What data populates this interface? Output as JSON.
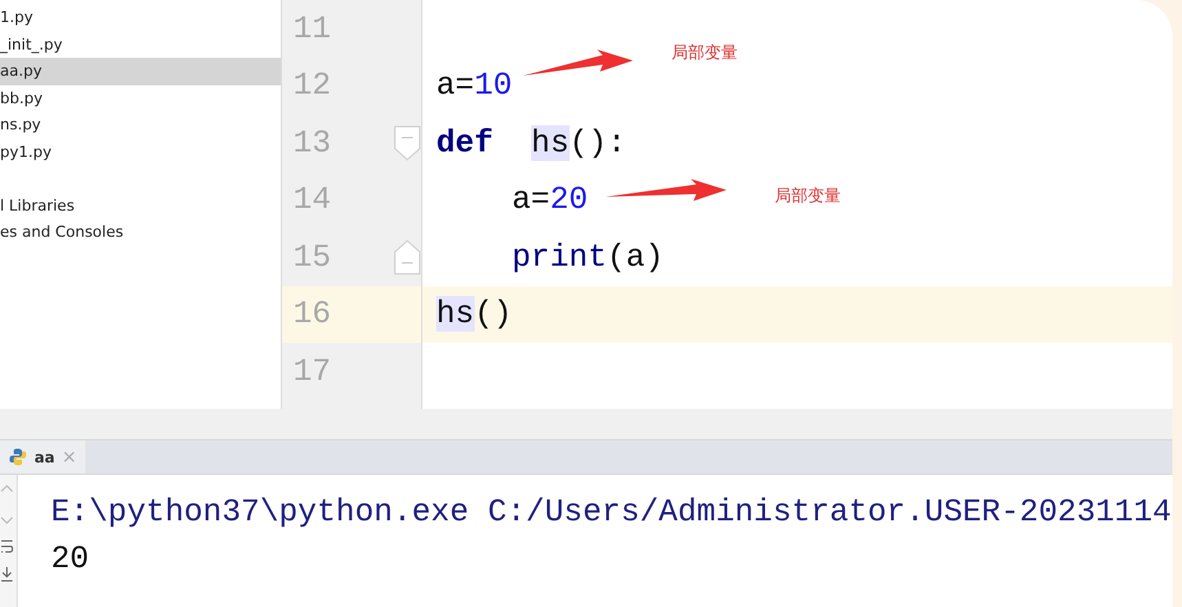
{
  "project_tree": {
    "items": [
      {
        "kind": "file",
        "label": "1.py",
        "selected": false
      },
      {
        "kind": "file",
        "label": "_init_.py",
        "selected": false
      },
      {
        "kind": "file",
        "label": "aa.py",
        "selected": true
      },
      {
        "kind": "file",
        "label": "bb.py",
        "selected": false
      },
      {
        "kind": "file",
        "label": "ns.py",
        "selected": false
      },
      {
        "kind": "file",
        "label": "py1.py",
        "selected": false
      },
      {
        "kind": "group",
        "label": "l Libraries",
        "selected": false
      },
      {
        "kind": "group",
        "label": "es and Consoles",
        "selected": false
      }
    ]
  },
  "editor": {
    "lines": [
      {
        "kind": "plain",
        "number": "11",
        "current": false
      },
      {
        "kind": "plain",
        "number": "12",
        "current": false,
        "indent": false,
        "tokens": [
          {
            "kind": "text",
            "text": "a="
          },
          {
            "kind": "number",
            "text": "10"
          }
        ]
      },
      {
        "kind": "foldstart",
        "number": "13",
        "current": false,
        "indent": false,
        "tokens": [
          {
            "kind": "keyword",
            "text": "def"
          },
          {
            "kind": "usage",
            "text": "hs"
          },
          {
            "kind": "text",
            "text": "():"
          }
        ]
      },
      {
        "kind": "plain",
        "number": "14",
        "current": false,
        "indent": true,
        "tokens": [
          {
            "kind": "text",
            "text": "a="
          },
          {
            "kind": "number",
            "text": "20"
          }
        ]
      },
      {
        "kind": "foldend",
        "number": "15",
        "current": false,
        "indent": true,
        "tokens": [
          {
            "kind": "builtin",
            "text": "print"
          },
          {
            "kind": "text",
            "text": "(a)"
          }
        ]
      },
      {
        "kind": "plain",
        "number": "16",
        "current": true,
        "indent": false,
        "tokens": [
          {
            "kind": "usage",
            "text": "hs"
          },
          {
            "kind": "text",
            "text": "()"
          }
        ]
      },
      {
        "kind": "plain",
        "number": "17",
        "current": false
      }
    ],
    "annotations": [
      {
        "label": "局部变量"
      },
      {
        "label": "局部变量"
      }
    ]
  },
  "run_panel": {
    "tabs": [
      {
        "label": "aa",
        "close": "×",
        "selected": true
      }
    ],
    "output": [
      {
        "kind": "command",
        "text": "E:\\python37\\python.exe C:/Users/Administrator.USER-20231114"
      },
      {
        "kind": "result",
        "text": "20"
      }
    ]
  }
}
